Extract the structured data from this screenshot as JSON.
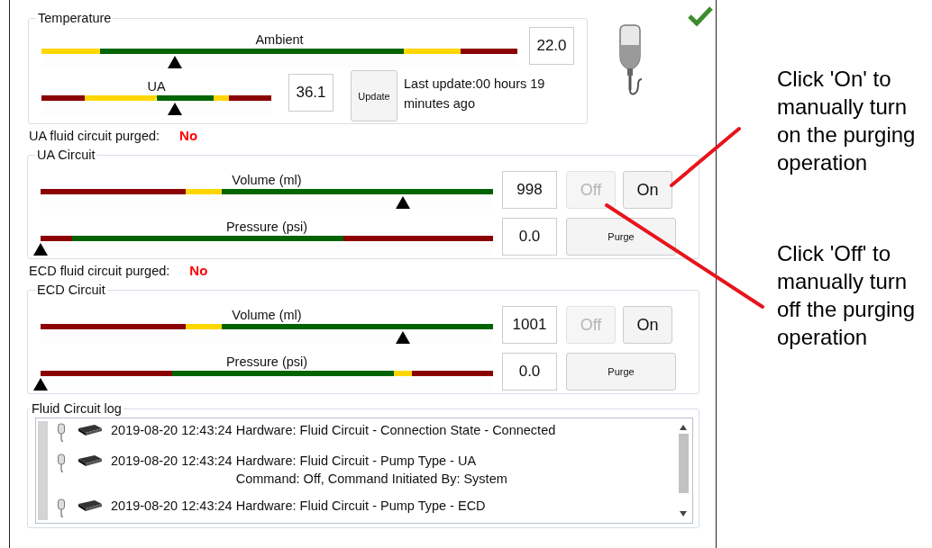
{
  "temperature": {
    "title": "Temperature",
    "gauges": [
      {
        "label": "Ambient",
        "value": "22.0",
        "pointer": {
          "level": 0.28
        },
        "segments": [
          {
            "color": "#ffd700",
            "level": 0.123
          },
          {
            "color": "#006400",
            "level": 0.761
          },
          {
            "color": "#ffd700",
            "level": 0.88
          },
          {
            "color": "#8b0000"
          }
        ]
      },
      {
        "label": "UA",
        "value": "36.1",
        "pointer": {
          "level": 0.58
        },
        "segments": [
          {
            "color": "#8b0000",
            "level": 0.19
          },
          {
            "color": "#ffd700",
            "level": 0.5
          },
          {
            "color": "#006400",
            "level": 0.75
          },
          {
            "color": "#ffd700",
            "level": 0.815
          },
          {
            "color": "#8b0000"
          }
        ]
      }
    ],
    "update_button": "Update",
    "last_update": "Last update:00 hours 19 minutes ago"
  },
  "circuits": [
    {
      "purged_label": "UA fluid circuit purged:",
      "purged_value": "No",
      "title": "UA Circuit",
      "gauges": [
        {
          "label": "Volume (ml)",
          "value": "998",
          "pointer": {
            "level": 0.8
          },
          "segments": [
            {
              "color": "#8b0000",
              "level": 0.32
            },
            {
              "color": "#ffd700",
              "level": 0.4
            },
            {
              "color": "#006400"
            }
          ]
        },
        {
          "label": "Pressure (psi)",
          "value": "0.0",
          "pointer": {
            "level": 0
          },
          "segments": [
            {
              "color": "#8b0000",
              "level": 0.07
            },
            {
              "color": "#006400",
              "level": 0.67
            },
            {
              "color": "#8b0000"
            }
          ]
        }
      ],
      "off_button": {
        "label": "Off",
        "disabled": true
      },
      "on_button": {
        "label": "On",
        "disabled": false
      },
      "purge_button": "Purge"
    },
    {
      "purged_label": "ECD fluid circuit purged:",
      "purged_value": "No",
      "title": "ECD Circuit",
      "gauges": [
        {
          "label": "Volume (ml)",
          "value": "1001",
          "pointer": {
            "level": 0.8
          },
          "segments": [
            {
              "color": "#8b0000",
              "level": 0.32
            },
            {
              "color": "#ffd700",
              "level": 0.4
            },
            {
              "color": "#006400"
            }
          ]
        },
        {
          "label": "Pressure (psi)",
          "value": "0.0",
          "pointer": {
            "level": 0
          },
          "segments": [
            {
              "color": "#8b0000",
              "level": 0.29
            },
            {
              "color": "#006400",
              "level": 0.78
            },
            {
              "color": "#ffd700",
              "level": 0.82
            },
            {
              "color": "#8b0000"
            }
          ]
        }
      ],
      "off_button": {
        "label": "Off",
        "disabled": true
      },
      "on_button": {
        "label": "On",
        "disabled": false
      },
      "purge_button": "Purge"
    }
  ],
  "log": {
    "title": "Fluid Circuit log",
    "entries": [
      {
        "timestamp": "2019-08-20 12:43:24",
        "message": "Hardware: Fluid Circuit - Connection State - Connected"
      },
      {
        "timestamp": "2019-08-20 12:43:24",
        "message": "Hardware: Fluid Circuit - Pump Type - UA",
        "detail": "Command: Off, Command Initiated By: System"
      },
      {
        "timestamp": "2019-08-20 12:43:24",
        "message": "Hardware: Fluid Circuit - Pump Type - ECD"
      }
    ]
  },
  "annotations": [
    {
      "text": "Click 'On' to manually turn on the purging operation"
    },
    {
      "text": "Click 'Off' to manually turn off the purging operation"
    }
  ]
}
